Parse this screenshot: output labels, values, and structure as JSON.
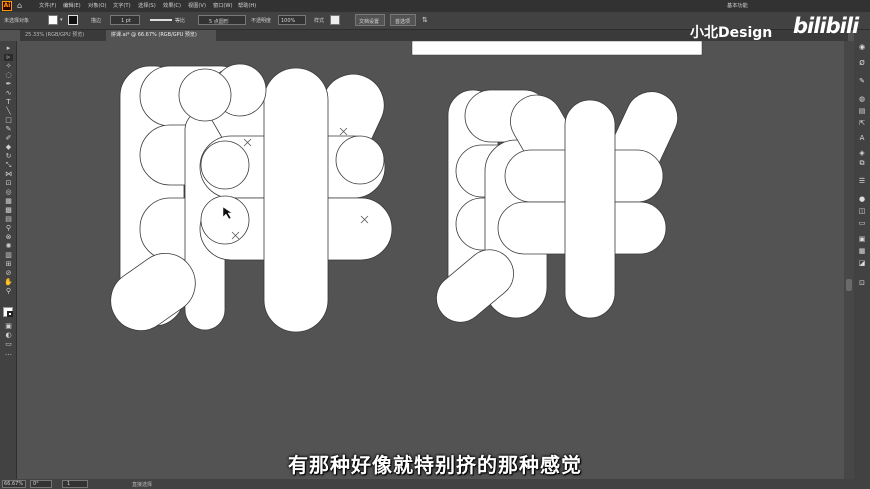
{
  "menubar": {
    "app_icon": "Ai",
    "items": [
      "文件(F)",
      "编辑(E)",
      "对象(O)",
      "文字(T)",
      "选择(S)",
      "效果(C)",
      "视图(V)",
      "窗口(W)",
      "帮助(H)"
    ],
    "workspace": "基本功能"
  },
  "controlbar": {
    "selection_label": "未选择对象",
    "stroke_label": "描边",
    "stroke_value": "1 pt",
    "stroke_profile": "等比",
    "brush": "5 点圆形",
    "opacity_label": "不透明度",
    "opacity_value": "100%",
    "style_label": "样式",
    "doc_setup": "文档设置",
    "preferences": "首选项"
  },
  "tabs": [
    {
      "label": "25.33% (RGB/GPU 预览)"
    },
    {
      "label": "拼课.ai* @ 66.67% (RGB/GPU 预览)"
    }
  ],
  "statusbar": {
    "zoom": "66.67%",
    "angle": "0°",
    "artboard": "1",
    "mode": "直接选择"
  },
  "subtitle": "有那种好像就特别挤的那种感觉",
  "watermark": {
    "text": "小北Design",
    "brand": "bilibili"
  },
  "colors": {
    "canvas": "#535353",
    "shape_fill": "#ffffff",
    "shape_stroke": "#3a3a3a",
    "ui_dark": "#424242"
  }
}
